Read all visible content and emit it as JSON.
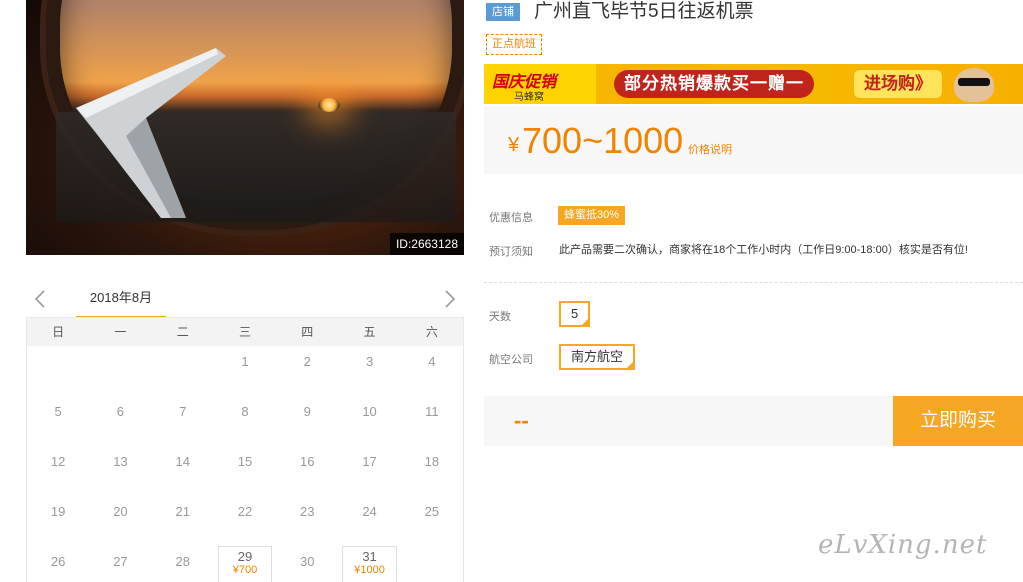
{
  "photo": {
    "id_text": "ID:2663128"
  },
  "calendar": {
    "month": "2018年8月",
    "weekdays": [
      "日",
      "一",
      "二",
      "三",
      "四",
      "五",
      "六"
    ],
    "rows": [
      [
        "",
        "",
        "",
        "1",
        "2",
        "3",
        "4"
      ],
      [
        "5",
        "6",
        "7",
        "8",
        "9",
        "10",
        "11"
      ],
      [
        "12",
        "13",
        "14",
        "15",
        "16",
        "17",
        "18"
      ],
      [
        "19",
        "20",
        "21",
        "22",
        "23",
        "24",
        "25"
      ],
      [
        "26",
        "27",
        "28",
        "29",
        "30",
        "31",
        ""
      ]
    ],
    "prices": {
      "29": "¥700",
      "31": "¥1000"
    }
  },
  "header": {
    "shop_badge": "店铺",
    "title": "广州直飞毕节5日往返机票",
    "ontime_tag": "正点航班"
  },
  "banner": {
    "festival": "国庆促销",
    "brand": "马蜂窝",
    "headline": "部分热销爆款买一赠一",
    "cta": "进场购》"
  },
  "price": {
    "currency": "¥",
    "range": "700~1000",
    "note": "价格说明"
  },
  "info": {
    "discount_label": "优惠信息",
    "discount_badge": "蜂蜜抵30%",
    "notice_label": "预订须知",
    "notice_text": "此产品需要二次确认，商家将在18个工作小时内（工作日9:00-18:00）核实是否有位!"
  },
  "options": {
    "days_label": "天数",
    "days_value": "5",
    "airline_label": "航空公司",
    "airline_value": "南方航空"
  },
  "purchase": {
    "total": "--",
    "buy_label": "立即购买"
  },
  "watermark": "eLvXing.net",
  "colors": {
    "accent": "#f5a623",
    "price": "#f08300",
    "badge_blue": "#5b9bd5"
  }
}
